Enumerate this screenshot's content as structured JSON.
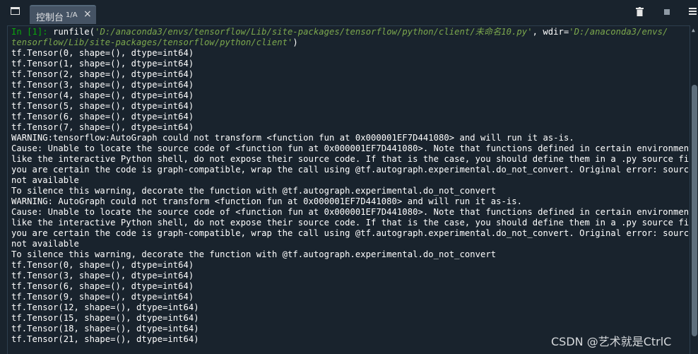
{
  "tab": {
    "label": "控制台",
    "sub": "1/A",
    "close": "×"
  },
  "icons": {
    "window": "window-icon",
    "trash": "trash-icon",
    "stop": "stop-icon",
    "menu": "menu-icon"
  },
  "console": {
    "prompt": "In [1]:",
    "run_cmd": " runfile(",
    "path1": "'D:/anaconda3/envs/tensorflow/Lib/site-packages/tensorflow/python/client/未命名10.py'",
    "wdir_label": ", wdir=",
    "path2_part1": "'D:/anaconda3/envs/",
    "path2_part2": "tensorflow/Lib/site-packages/tensorflow/python/client'",
    "close_paren": ")",
    "output": [
      "tf.Tensor(0, shape=(), dtype=int64)",
      "tf.Tensor(1, shape=(), dtype=int64)",
      "tf.Tensor(2, shape=(), dtype=int64)",
      "tf.Tensor(3, shape=(), dtype=int64)",
      "tf.Tensor(4, shape=(), dtype=int64)",
      "tf.Tensor(5, shape=(), dtype=int64)",
      "tf.Tensor(6, shape=(), dtype=int64)",
      "tf.Tensor(7, shape=(), dtype=int64)",
      "WARNING:tensorflow:AutoGraph could not transform <function fun at 0x000001EF7D441080> and will run it as-is.",
      "Cause: Unable to locate the source code of <function fun at 0x000001EF7D441080>. Note that functions defined in certain environments,",
      "like the interactive Python shell, do not expose their source code. If that is the case, you should define them in a .py source file. If",
      "you are certain the code is graph-compatible, wrap the call using @tf.autograph.experimental.do_not_convert. Original error: source code",
      "not available",
      "To silence this warning, decorate the function with @tf.autograph.experimental.do_not_convert",
      "WARNING: AutoGraph could not transform <function fun at 0x000001EF7D441080> and will run it as-is.",
      "Cause: Unable to locate the source code of <function fun at 0x000001EF7D441080>. Note that functions defined in certain environments,",
      "like the interactive Python shell, do not expose their source code. If that is the case, you should define them in a .py source file. If",
      "you are certain the code is graph-compatible, wrap the call using @tf.autograph.experimental.do_not_convert. Original error: source code",
      "not available",
      "To silence this warning, decorate the function with @tf.autograph.experimental.do_not_convert",
      "tf.Tensor(0, shape=(), dtype=int64)",
      "tf.Tensor(3, shape=(), dtype=int64)",
      "tf.Tensor(6, shape=(), dtype=int64)",
      "tf.Tensor(9, shape=(), dtype=int64)",
      "tf.Tensor(12, shape=(), dtype=int64)",
      "tf.Tensor(15, shape=(), dtype=int64)",
      "tf.Tensor(18, shape=(), dtype=int64)",
      "tf.Tensor(21, shape=(), dtype=int64)"
    ]
  },
  "watermark": "CSDN @艺术就是CtrlC",
  "colors": {
    "background": "#19232d",
    "tab": "#455364",
    "prompt": "#0ba70b",
    "string": "#7ca84d",
    "text": "#ffffff"
  }
}
